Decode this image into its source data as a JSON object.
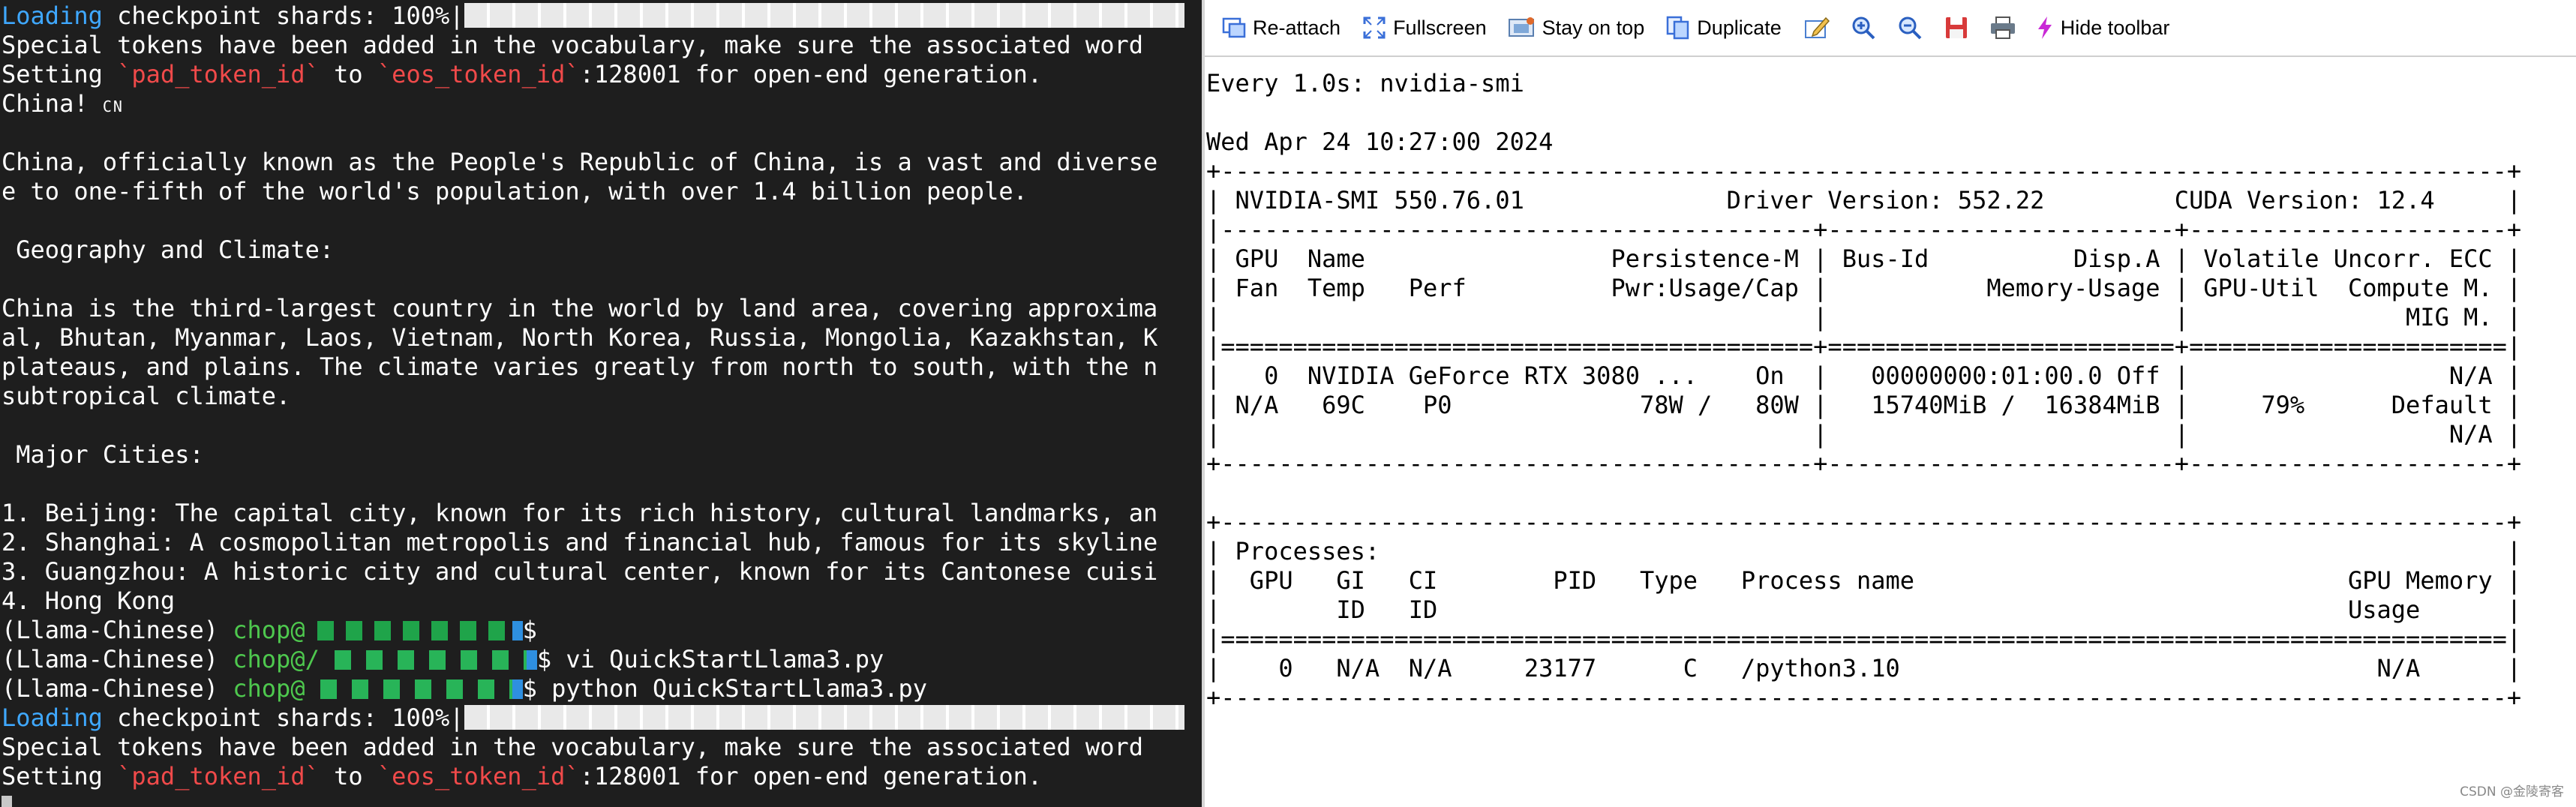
{
  "left_terminal": {
    "lines": [
      {
        "segments": [
          {
            "t": "Loading",
            "c": "cyan"
          },
          {
            "t": " checkpoint shards: 100%|"
          },
          {
            "bar": true
          }
        ]
      },
      {
        "segments": [
          {
            "t": "Special tokens have been added in the vocabulary, make sure the associated word"
          }
        ]
      },
      {
        "segments": [
          {
            "t": "Setting "
          },
          {
            "t": "`pad_token_id`",
            "c": "red"
          },
          {
            "t": " to "
          },
          {
            "t": "`eos_token_id`",
            "c": "red"
          },
          {
            "t": ":128001 for open-end generation."
          }
        ]
      },
      {
        "segments": [
          {
            "t": "China! "
          },
          {
            "t": "CN",
            "c": "cn"
          }
        ]
      },
      {
        "segments": []
      },
      {
        "segments": [
          {
            "t": "China, officially known as the People's Republic of China, is a vast and diverse"
          }
        ]
      },
      {
        "segments": [
          {
            "t": "e to one-fifth of the world's population, with over 1.4 billion people."
          }
        ]
      },
      {
        "segments": []
      },
      {
        "segments": [
          {
            "t": " Geography and Climate:"
          }
        ]
      },
      {
        "segments": []
      },
      {
        "segments": [
          {
            "t": "China is the third-largest country in the world by land area, covering approxima"
          }
        ]
      },
      {
        "segments": [
          {
            "t": "al, Bhutan, Myanmar, Laos, Vietnam, North Korea, Russia, Mongolia, Kazakhstan, K"
          }
        ]
      },
      {
        "segments": [
          {
            "t": "plateaus, and plains. The climate varies greatly from north to south, with the n"
          }
        ]
      },
      {
        "segments": [
          {
            "t": "subtropical climate."
          }
        ]
      },
      {
        "segments": []
      },
      {
        "segments": [
          {
            "t": " Major Cities:"
          }
        ]
      },
      {
        "segments": []
      },
      {
        "segments": [
          {
            "t": "1. Beijing: The capital city, known for its rich history, cultural landmarks, an"
          }
        ]
      },
      {
        "segments": [
          {
            "t": "2. Shanghai: A cosmopolitan metropolis and financial hub, famous for its skyline"
          }
        ]
      },
      {
        "segments": [
          {
            "t": "3. Guangzhou: A historic city and cultural center, known for its Cantonese cuisi"
          }
        ]
      },
      {
        "segments": [
          {
            "t": "4. Hong Kong"
          }
        ]
      },
      {
        "segments": [
          {
            "t": "(Llama-Chinese) "
          },
          {
            "t": "chop@",
            "c": "green"
          },
          {
            "mask": "a"
          },
          {
            "t": "$"
          }
        ]
      },
      {
        "segments": [
          {
            "t": "(Llama-Chinese) "
          },
          {
            "t": "chop@/",
            "c": "green"
          },
          {
            "mask": "b"
          },
          {
            "t": "$ vi QuickStartLlama3.py"
          }
        ]
      },
      {
        "segments": [
          {
            "t": "(Llama-Chinese) "
          },
          {
            "t": "chop@",
            "c": "green"
          },
          {
            "mask": "b"
          },
          {
            "t": "$ python QuickStartLlama3.py"
          }
        ]
      },
      {
        "segments": [
          {
            "t": "Loading",
            "c": "cyan"
          },
          {
            "t": " checkpoint shards: 100%|"
          },
          {
            "bar": true
          }
        ]
      },
      {
        "segments": [
          {
            "t": "Special tokens have been added in the vocabulary, make sure the associated word"
          }
        ]
      },
      {
        "segments": [
          {
            "t": "Setting "
          },
          {
            "t": "`pad_token_id`",
            "c": "red"
          },
          {
            "t": " to "
          },
          {
            "t": "`eos_token_id`",
            "c": "red"
          },
          {
            "t": ":128001 for open-end generation."
          }
        ]
      },
      {
        "segments": [
          {
            "cursor": true
          }
        ]
      }
    ]
  },
  "toolbar": {
    "reattach": "Re-attach",
    "fullscreen": "Fullscreen",
    "stay_on_top": "Stay on top",
    "duplicate": "Duplicate",
    "hide_toolbar": "Hide toolbar"
  },
  "right_terminal": {
    "lines": [
      "Every 1.0s: nvidia-smi",
      "",
      "Wed Apr 24 10:27:00 2024",
      "+-----------------------------------------------------------------------------------------+",
      "| NVIDIA-SMI 550.76.01              Driver Version: 552.22         CUDA Version: 12.4     |",
      "|-----------------------------------------+------------------------+----------------------+",
      "| GPU  Name                 Persistence-M | Bus-Id          Disp.A | Volatile Uncorr. ECC |",
      "| Fan  Temp   Perf          Pwr:Usage/Cap |           Memory-Usage | GPU-Util  Compute M. |",
      "|                                         |                        |               MIG M. |",
      "|=========================================+========================+======================|",
      "|   0  NVIDIA GeForce RTX 3080 ...    On  |   00000000:01:00.0 Off |                  N/A |",
      "| N/A   69C    P0             78W /   80W |   15740MiB /  16384MiB |     79%      Default |",
      "|                                         |                        |                  N/A |",
      "+-----------------------------------------+------------------------+----------------------+",
      "",
      "+-----------------------------------------------------------------------------------------+",
      "| Processes:                                                                              |",
      "|  GPU   GI   CI        PID   Type   Process name                              GPU Memory |",
      "|        ID   ID                                                               Usage      |",
      "|=========================================================================================|",
      "|    0   N/A  N/A     23177      C   /python3.10                                 N/A      |",
      "+-----------------------------------------------------------------------------------------+"
    ]
  },
  "watermark": "CSDN @金陵寄客"
}
